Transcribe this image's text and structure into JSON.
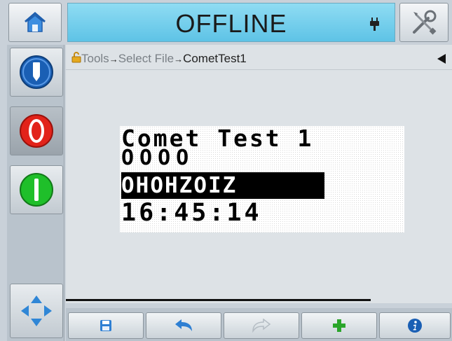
{
  "status": {
    "text": "OFFLINE",
    "color": "#6fd0ee"
  },
  "icons": {
    "home": "home-icon",
    "plug": "plug-icon",
    "tools": "tools-icon",
    "jet": "ink-jet-icon",
    "stop": "stop-icon",
    "start": "start-icon",
    "nav": "navigation-arrows-icon",
    "lock": "lock-icon",
    "collapse": "triangle-left-icon",
    "save": "save-icon",
    "undo": "undo-icon",
    "redo": "redo-icon",
    "add": "plus-icon",
    "info": "info-icon"
  },
  "breadcrumb": {
    "items": [
      "Tools",
      "Select File",
      "CometTest1"
    ],
    "separator": "→"
  },
  "preview": {
    "lines": [
      "Comet Test 1",
      "OOOO",
      "OHOHZOIZ",
      "16:45:14"
    ]
  },
  "progress": {
    "fraction": 0.79
  },
  "colors": {
    "stop": "#e2231a",
    "start": "#1fbf2a",
    "jet": "#1a5fb4",
    "add": "#2aa52a",
    "info": "#1a5fb4"
  }
}
